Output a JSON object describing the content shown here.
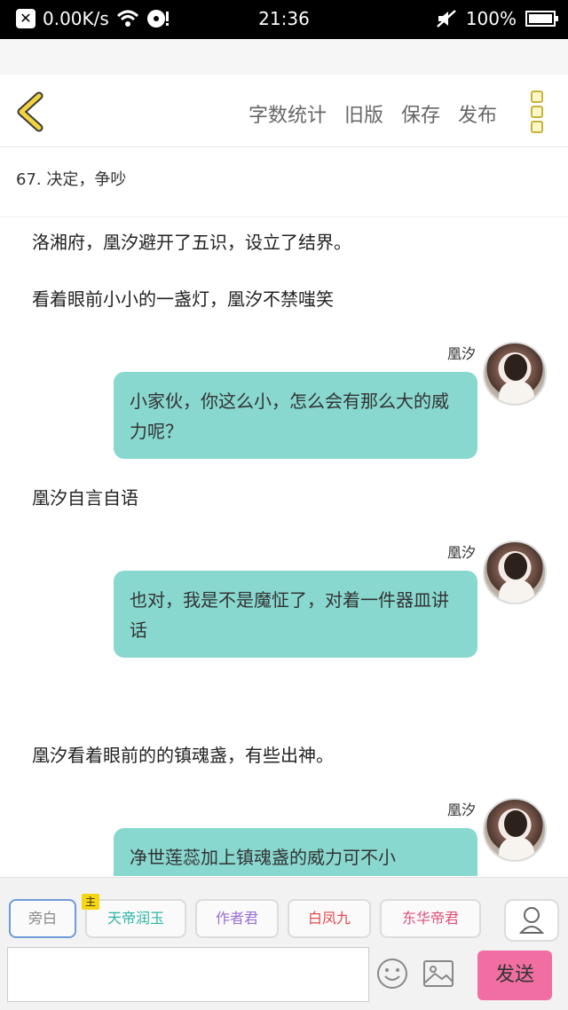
{
  "status_bar": {
    "network_speed": "0.00K/s",
    "time": "21:36",
    "battery": "100%",
    "battery_level": 1.0
  },
  "header": {
    "toolbar": [
      "字数统计",
      "旧版",
      "保存",
      "发布"
    ]
  },
  "chapter_title": "67. 决定，争吵",
  "content": {
    "lines": [
      "洛湘府，凰汐避开了五识，设立了结界。",
      "看着眼前小小的一盏灯，凰汐不禁嗤笑",
      "凰汐自言自语",
      "凰汐看着眼前的的镇魂盏，有些出神。"
    ],
    "messages": [
      {
        "speaker": "凰汐",
        "text": "小家伙，你这么小，怎么会有那么大的威力呢？"
      },
      {
        "speaker": "凰汐",
        "text": "也对，我是不是魔怔了，对着一件器皿讲话"
      },
      {
        "speaker": "凰汐",
        "text": "净世莲蕊加上镇魂盏的威力可不小"
      }
    ]
  },
  "bottom": {
    "chips": [
      {
        "label": "旁白",
        "color": "#888888"
      },
      {
        "label": "天帝润玉",
        "color": "#2bb5a5",
        "tag": "主"
      },
      {
        "label": "作者君",
        "color": "#9a6fd1"
      },
      {
        "label": "白凤九",
        "color": "#e04a4a"
      },
      {
        "label": "东华帝君",
        "color": "#e0507a"
      }
    ],
    "send_label": "发送",
    "input_value": ""
  }
}
